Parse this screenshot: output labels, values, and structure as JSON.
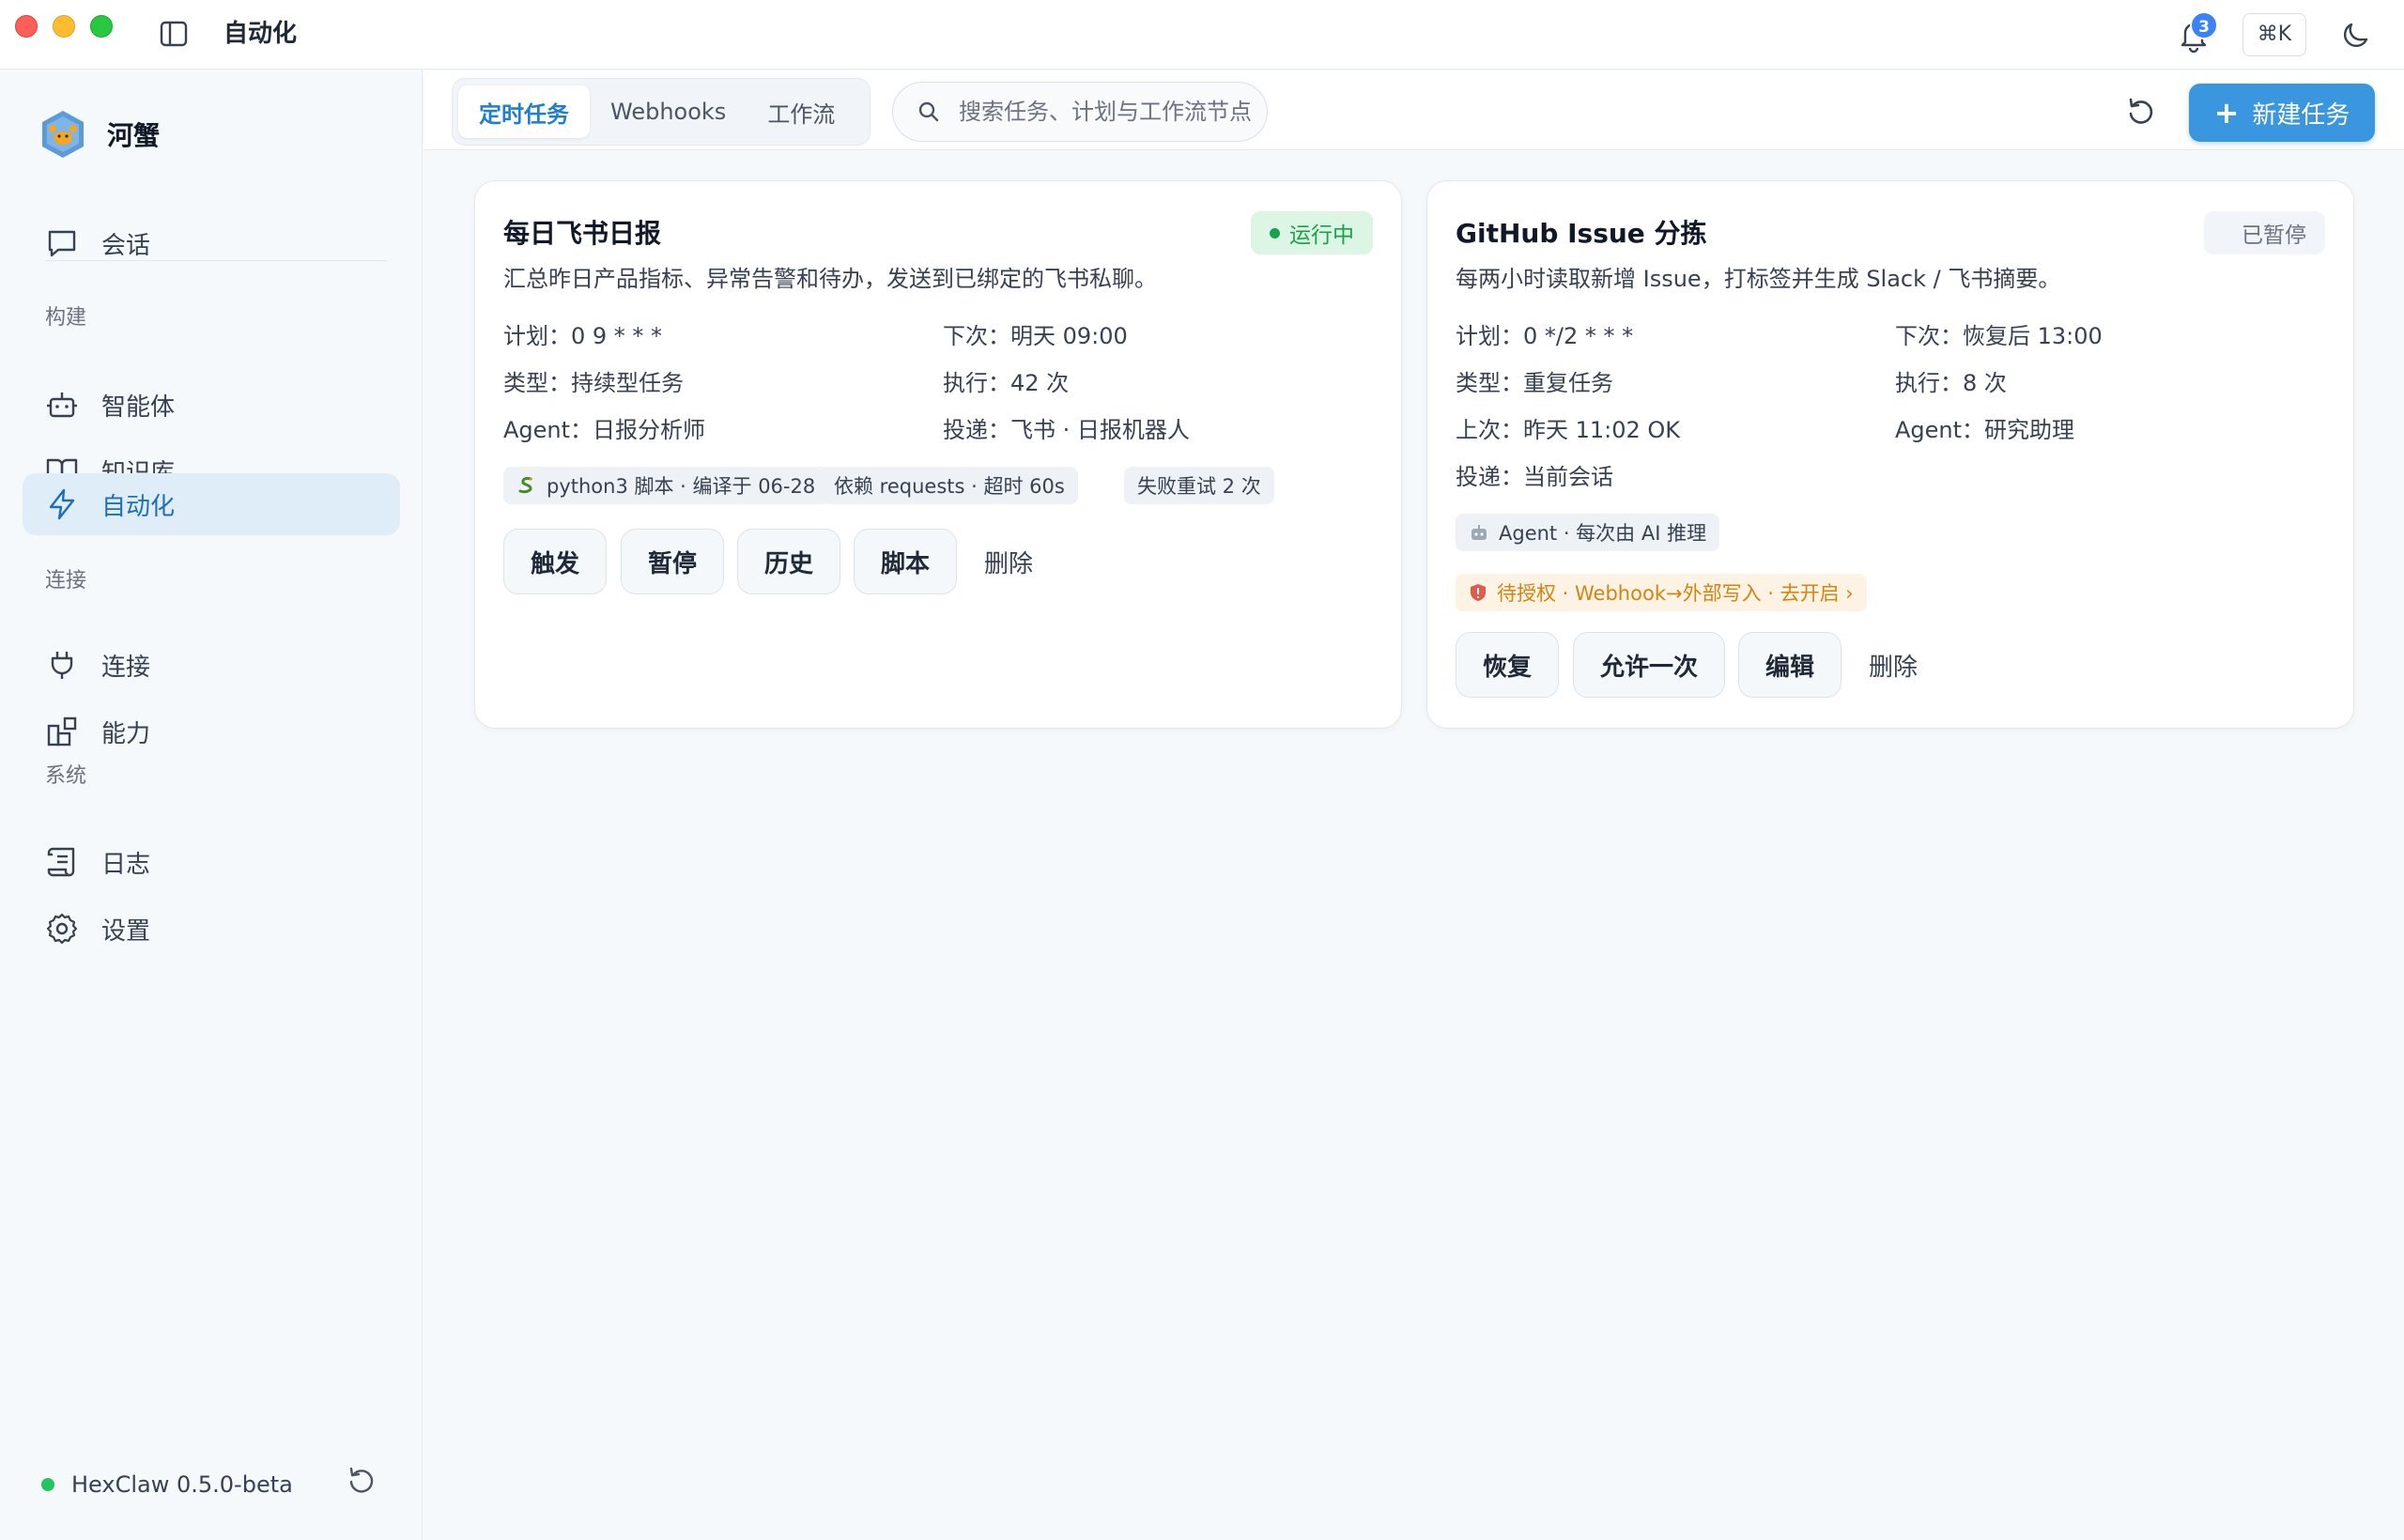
{
  "window": {
    "title": "自动化"
  },
  "header": {
    "notifications_count": "3",
    "shortcut": "⌘K"
  },
  "brand": {
    "name": "河蟹"
  },
  "sidebar": {
    "chat": "会话",
    "sections": {
      "build": "构建",
      "connect": "连接",
      "system": "系统"
    },
    "items": {
      "agents": "智能体",
      "knowledge": "知识库",
      "automation": "自动化",
      "connections": "连接",
      "capabilities": "能力",
      "logs": "日志",
      "settings": "设置"
    },
    "footer_version": "HexClaw 0.5.0-beta"
  },
  "toolbar": {
    "tabs": [
      "定时任务",
      "Webhooks",
      "工作流"
    ],
    "search_placeholder": "搜索任务、计划与工作流节点",
    "new_task": "新建任务"
  },
  "cards": [
    {
      "title": "每日飞书日报",
      "status": "运行中",
      "description": "汇总昨日产品指标、异常告警和待办，发送到已绑定的飞书私聊。",
      "meta": {
        "plan": "计划：0 9 * * *",
        "next": "下次：明天 09:00",
        "type": "类型：持续型任务",
        "runs": "执行：42 次",
        "agent": "Agent：日报分析师",
        "delivery": "投递：飞书 · 日报机器人"
      },
      "chips": [
        "python3 脚本 · 编译于 06-28",
        "依赖 requests · 超时 60s",
        "失败重试 2 次"
      ],
      "actions": [
        "触发",
        "暂停",
        "历史",
        "脚本",
        "删除"
      ]
    },
    {
      "title": "GitHub Issue 分拣",
      "status": "已暂停",
      "description": "每两小时读取新增 Issue，打标签并生成 Slack / 飞书摘要。",
      "meta": {
        "plan": "计划：0 */2 * * *",
        "next": "下次：恢复后 13:00",
        "type": "类型：重复任务",
        "runs": "执行：8 次",
        "last": "上次：昨天 11:02 OK",
        "agent": "Agent：研究助理",
        "delivery": "投递：当前会话"
      },
      "chips": [
        "Agent · 每次由 AI 推理",
        "待授权 · Webhook→外部写入 · 去开启 ›"
      ],
      "actions": [
        "恢复",
        "允许一次",
        "编辑",
        "删除"
      ]
    }
  ],
  "colors": {
    "accent": "#3b96e0",
    "active_nav_bg": "#deedf8",
    "running": "#16a34a",
    "warning": "#d48410"
  }
}
